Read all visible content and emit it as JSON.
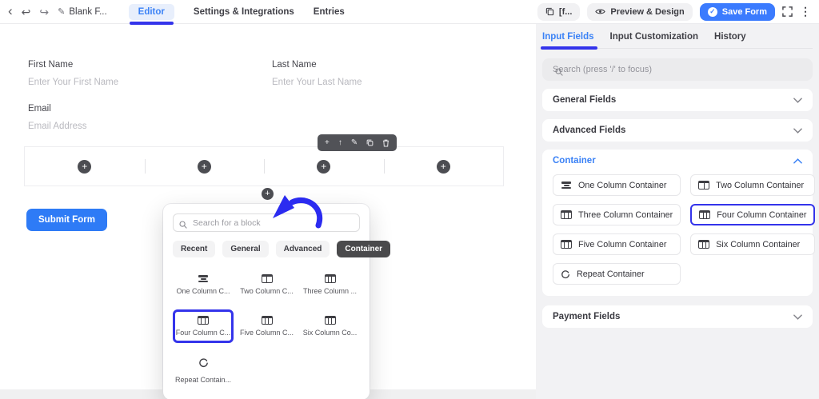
{
  "colors": {
    "accent": "#3434eb",
    "primary_button": "#3b7bfe",
    "submit_button": "#2e7bf6",
    "link_blue": "#3b82f6",
    "dark_pill": "#4a4a4c",
    "sidebar_bg": "#f2f2f4"
  },
  "icons": {
    "back": "‹",
    "undo": "↩",
    "redo": "↪",
    "edit": "✎",
    "more": "⋮",
    "check": "✓",
    "plus": "+",
    "move_up": "↑"
  },
  "topbar": {
    "form_title": "Blank F...",
    "tabs": [
      {
        "label": "Editor",
        "active": true
      },
      {
        "label": "Settings & Integrations",
        "active": false
      },
      {
        "label": "Entries",
        "active": false
      }
    ],
    "shortcode_button": "[f...",
    "preview_button": "Preview & Design",
    "save_button": "Save Form"
  },
  "canvas": {
    "fields": [
      {
        "label": "First Name",
        "placeholder": "Enter Your First Name"
      },
      {
        "label": "Last Name",
        "placeholder": "Enter Your Last Name"
      },
      {
        "label": "Email",
        "placeholder": "Email Address"
      }
    ],
    "submit_button": "Submit Form"
  },
  "block_popup": {
    "search_placeholder": "Search for a block",
    "tabs": [
      {
        "label": "Recent",
        "active": false
      },
      {
        "label": "General",
        "active": false
      },
      {
        "label": "Advanced",
        "active": false
      },
      {
        "label": "Container",
        "active": true
      }
    ],
    "blocks": [
      {
        "label": "One Column C...",
        "selected": false
      },
      {
        "label": "Two Column C...",
        "selected": false
      },
      {
        "label": "Three Column ...",
        "selected": false
      },
      {
        "label": "Four Column C...",
        "selected": true
      },
      {
        "label": "Five Column C...",
        "selected": false
      },
      {
        "label": "Six Column Co...",
        "selected": false
      },
      {
        "label": "Repeat Contain...",
        "selected": false
      }
    ]
  },
  "sidebar": {
    "tabs": [
      {
        "label": "Input Fields",
        "active": true
      },
      {
        "label": "Input Customization",
        "active": false
      },
      {
        "label": "History",
        "active": false
      }
    ],
    "search_placeholder": "Search (press '/' to focus)",
    "sections": {
      "general": {
        "label": "General Fields",
        "expanded": false
      },
      "advanced": {
        "label": "Advanced Fields",
        "expanded": false
      },
      "container": {
        "label": "Container",
        "expanded": true,
        "items": [
          {
            "label": "One Column Container",
            "selected": false
          },
          {
            "label": "Two Column Container",
            "selected": false
          },
          {
            "label": "Three Column Container",
            "selected": false
          },
          {
            "label": "Four Column Container",
            "selected": true
          },
          {
            "label": "Five Column Container",
            "selected": false
          },
          {
            "label": "Six Column Container",
            "selected": false
          },
          {
            "label": "Repeat Container",
            "selected": false
          }
        ]
      },
      "payment": {
        "label": "Payment Fields",
        "expanded": false
      }
    }
  }
}
